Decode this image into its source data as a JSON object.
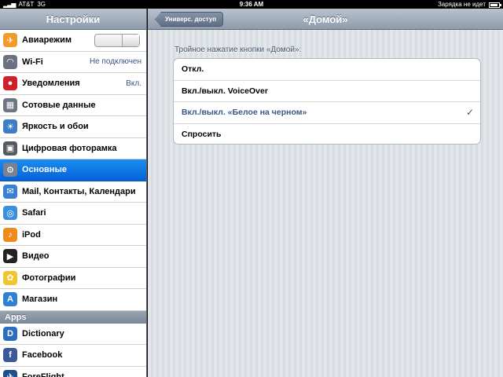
{
  "status_bar": {
    "carrier": "AT&T",
    "network": "3G",
    "time": "9:36 AM",
    "battery_text": "Зарядка не идет"
  },
  "master": {
    "title": "Настройки",
    "items": [
      {
        "label": "Авиарежим",
        "icon": "airplane-icon",
        "color": "#f29a2a",
        "glyph": "✈",
        "toggle": true
      },
      {
        "label": "Wi-Fi",
        "icon": "wifi-icon",
        "color": "#6a7280",
        "glyph": "◠",
        "value": "Не подключен"
      },
      {
        "label": "Уведомления",
        "icon": "notifications-icon",
        "color": "#d0202a",
        "glyph": "●",
        "value": "Вкл."
      },
      {
        "label": "Сотовые данные",
        "icon": "cellular-icon",
        "color": "#6e7684",
        "glyph": "▦"
      },
      {
        "label": "Яркость и обои",
        "icon": "brightness-icon",
        "color": "#3f7cc4",
        "glyph": "☀"
      },
      {
        "label": "Цифровая фоторамка",
        "icon": "photo-frame-icon",
        "color": "#555a61",
        "glyph": "▣"
      },
      {
        "label": "Основные",
        "icon": "gear-icon",
        "color": "#7a8290",
        "glyph": "⚙",
        "selected": true
      },
      {
        "label": "Mail, Контакты, Календари",
        "icon": "mail-icon",
        "color": "#3a7fd6",
        "glyph": "✉"
      },
      {
        "label": "Safari",
        "icon": "safari-icon",
        "color": "#3c8fe0",
        "glyph": "◎"
      },
      {
        "label": "iPod",
        "icon": "ipod-icon",
        "color": "#ef8a1c",
        "glyph": "♪"
      },
      {
        "label": "Видео",
        "icon": "video-icon",
        "color": "#222222",
        "glyph": "▶"
      },
      {
        "label": "Фотографии",
        "icon": "photos-icon",
        "color": "#f1c52c",
        "glyph": "✿"
      },
      {
        "label": "Магазин",
        "icon": "store-icon",
        "color": "#2f7fd2",
        "glyph": "A"
      }
    ],
    "apps_header": "Apps",
    "apps": [
      {
        "label": "Dictionary",
        "icon": "dictionary-icon",
        "color": "#2d6dc0",
        "glyph": "D"
      },
      {
        "label": "Facebook",
        "icon": "facebook-icon",
        "color": "#3b5998",
        "glyph": "f"
      },
      {
        "label": "ForeFlight",
        "icon": "foreflight-icon",
        "color": "#1c4f8f",
        "glyph": "✈"
      }
    ]
  },
  "detail": {
    "back_label": "Универс. доступ",
    "title": "«Домой»",
    "group_title": "Тройное нажатие кнопки «Домой»:",
    "options": [
      {
        "label": "Откл.",
        "checked": false
      },
      {
        "label": "Вкл./выкл. VoiceOver",
        "checked": false
      },
      {
        "label": "Вкл./выкл. «Белое на черном»",
        "checked": true
      },
      {
        "label": "Спросить",
        "checked": false
      }
    ],
    "check_glyph": "✓"
  }
}
